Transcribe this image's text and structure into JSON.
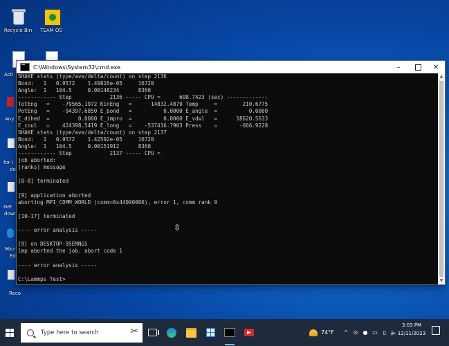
{
  "desktop": {
    "icons": [
      {
        "label": "Recycle Bin"
      },
      {
        "label": "TEAM OS"
      },
      {
        "label": ""
      }
    ],
    "partial_labels": [
      "Acti",
      "Any",
      "for I",
      "do",
      "Get",
      "down",
      "Micr",
      "Ed",
      "Reco"
    ]
  },
  "window": {
    "title": "C:\\Windows\\System32\\cmd.exe",
    "minimize": "–",
    "maximize": "",
    "close": "✕"
  },
  "console": {
    "lines": [
      "SHAKE stats (type/ave/delta/count) on step 2136",
      "Bond:   1   0.9572    1.49816e-05     16720",
      "Angle:  1   104.5     0.00148234      8360",
      "------------ Step            2136 ----- CPU =      608.7423 (sec) -------------",
      "TotEng   =    -79565.1972 KinEng   =      14832.4879 Temp     =        210.6775",
      "PotEng   =    -94397.6850 E_bond   =          0.0000 E_angle  =          0.0000",
      "E_dihed  =         0.0000 E_impro  =          0.0000 E_vdwl   =      18620.5633",
      "E_coul   =    424398.5419 E_long   =    -537416.7903 Press    =       -666.9228",
      "SHAKE stats (type/ave/delta/count) on step 2137",
      "Bond:   1   0.9572    1.42592e-05     16720",
      "Angle:  1   104.5     0.00151912      8360",
      "------------ Step            2137 ----- CPU =",
      "job aborted:",
      "[ranks] message",
      "",
      "[0-8] terminated",
      "",
      "[9] application aborted",
      "aborting MPI_COMM_WORLD (comm=0x44000000), error 1, comm rank 9",
      "",
      "[10-17] terminated",
      "",
      "---- error analysis -----",
      "",
      "[9] on DESKTOP-95EMNG5",
      "lmp aborted the job. abort code 1",
      "",
      "---- error analysis -----",
      "",
      "C:\\Lammps Test>"
    ]
  },
  "taskbar": {
    "search_placeholder": "Type here to search",
    "weather_temp": "74°F",
    "time": "3:03 PM",
    "date": "12/11/2023",
    "tray_chevron": "^"
  }
}
